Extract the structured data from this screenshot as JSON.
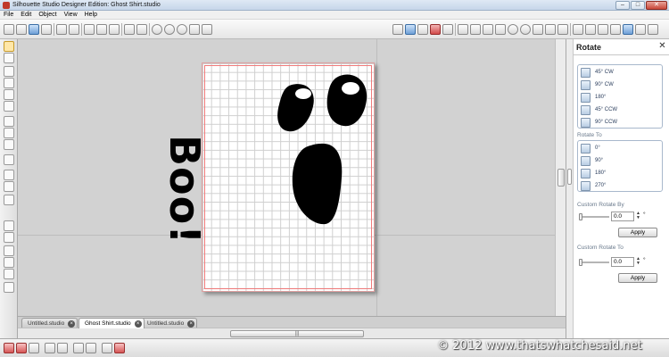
{
  "window": {
    "title": "Silhouette Studio Designer Edition: Ghost Shirt.studio",
    "minimize_label": "–",
    "maximize_label": "□",
    "close_label": "✕"
  },
  "menu": {
    "items": [
      "File",
      "Edit",
      "Object",
      "View",
      "Help"
    ]
  },
  "canvas": {
    "design_text": "Boo!"
  },
  "tabs": [
    {
      "label": "Untitled.studio",
      "active": false
    },
    {
      "label": "Ghost Shirt.studio",
      "active": true
    },
    {
      "label": "Untitled.studio",
      "active": false
    }
  ],
  "tab_close_glyph": "×",
  "hscroll_grip": "|||",
  "panel": {
    "title": "Rotate",
    "close_glyph": "✕",
    "rotate_options": [
      "45° CW",
      "90° CW",
      "180°",
      "45° CCW",
      "90° CCW"
    ],
    "rotate_to_label": "Rotate To",
    "rotate_to_options": [
      "0°",
      "90°",
      "180°",
      "270°"
    ],
    "custom_rotate_by_label": "Custom Rotate By",
    "custom_rotate_by_value": "0.0",
    "custom_rotate_by_unit": "°",
    "custom_rotate_to_label": "Custom Rotate To",
    "custom_rotate_to_value": "0.0",
    "custom_rotate_to_unit": "°",
    "apply_label": "Apply"
  },
  "watermark": "© 2012 www.thatswhatchesaid.net",
  "colors": {
    "cut_line": "#f07a7a",
    "shape_fill": "#000000",
    "panel_accent": "#2a3d5c"
  }
}
